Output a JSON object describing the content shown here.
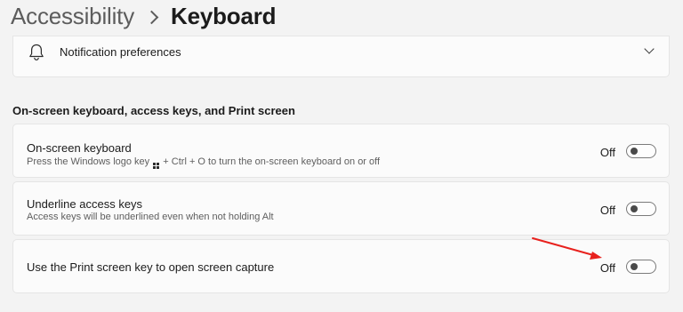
{
  "breadcrumb": {
    "parent": "Accessibility",
    "current": "Keyboard"
  },
  "notification_card": {
    "label": "Notification preferences",
    "icon": "bell-icon",
    "expand_icon": "chevron-down-icon"
  },
  "section": {
    "header": "On-screen keyboard, access keys, and Print screen"
  },
  "settings": [
    {
      "title": "On-screen keyboard",
      "description_before_icon": "Press the Windows logo key",
      "description_icon": "windows-logo-icon",
      "description_after_icon": "+ Ctrl + O to turn the on-screen keyboard on or off",
      "toggle_label": "Off",
      "toggle_state": false
    },
    {
      "title": "Underline access keys",
      "description": "Access keys will be underlined even when not holding Alt",
      "toggle_label": "Off",
      "toggle_state": false
    },
    {
      "title": "Use the Print screen key to open screen capture",
      "toggle_label": "Off",
      "toggle_state": false
    }
  ],
  "colors": {
    "background": "#f3f3f3",
    "card": "#fbfbfb",
    "annotation_arrow": "#e8211d"
  }
}
